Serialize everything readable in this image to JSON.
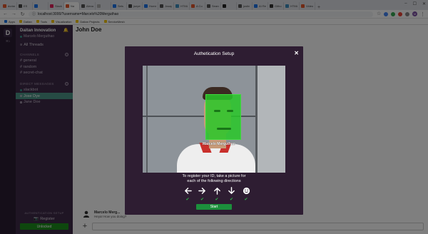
{
  "browser": {
    "tabs": [
      {
        "label": "doriar",
        "color": "#e2572b"
      },
      {
        "label": "ES",
        "color": "#444"
      },
      {
        "label": "",
        "color": "#1a73e8"
      },
      {
        "label": "Slack",
        "color": "#e01e5a"
      },
      {
        "label": "Na",
        "color": "#e2572b",
        "active": true
      },
      {
        "label": "Alexa",
        "color": "#555"
      },
      {
        "label": "",
        "color": "#aaa"
      },
      {
        "label": "Sets",
        "color": "#1a73e8"
      },
      {
        "label": "jseyes",
        "color": "#444"
      },
      {
        "label": "Home",
        "color": "#1a73e8"
      },
      {
        "label": "Josap",
        "color": "#555"
      },
      {
        "label": "HTML",
        "color": "#3c8dbc"
      },
      {
        "label": "A Co",
        "color": "#e2572b"
      },
      {
        "label": "Searc",
        "color": "#555"
      },
      {
        "label": "",
        "color": "#222"
      },
      {
        "label": "justin",
        "color": "#555"
      },
      {
        "label": "AI Re",
        "color": "#1a73e8"
      },
      {
        "label": "Githo",
        "color": "#333"
      },
      {
        "label": "HTML",
        "color": "#3c8dbc"
      },
      {
        "label": "Video",
        "color": "#e2572b"
      }
    ],
    "new_tab": "+",
    "window_controls": [
      "–",
      "☐",
      "✕"
    ],
    "nav": {
      "back": "←",
      "forward": "→",
      "reload": "↻"
    },
    "url": "localhost:3000/?username=Marcelo%20Merguthao",
    "profile_initial": "M",
    "bookmarks": [
      {
        "label": "Apps",
        "icon": "apps"
      },
      {
        "label": "Daitan"
      },
      {
        "label": "Tools"
      },
      {
        "label": "Visualization"
      },
      {
        "label": "Daitan Projects"
      },
      {
        "label": "ServiceMesh"
      }
    ]
  },
  "rail": {
    "logo": "D",
    "shortcut": "⌘1"
  },
  "sidebar": {
    "team_name": "Daitan Innovation",
    "bell_icon": "🔔",
    "current_user": "Marcelo Merguthao",
    "all_threads": "All Threads",
    "channels_header": "CHANNELS",
    "channels": [
      "# general",
      "# random",
      "# secret-chat"
    ],
    "dm_header": "DIRECT MESSAGES",
    "dms": [
      {
        "label": "slackbot",
        "active": false
      },
      {
        "label": "Jose Dye",
        "active": true
      },
      {
        "label": "Jane Doe",
        "active": false
      }
    ],
    "auth_header": "AUTHENTICATION SETUP",
    "register_label": "Register",
    "status_label": "Unlocked"
  },
  "main": {
    "title": "John Doe",
    "message": {
      "author": "Marcelo Merg...",
      "text": "Heya! How you doing?"
    },
    "composer": {
      "add": "+",
      "placeholder": ""
    }
  },
  "modal": {
    "title": "Authetication Setup",
    "close": "✕",
    "face_label": "Marcelo Merguthao",
    "instruction_line1": "To register your ID, take a picture for",
    "instruction_line2": "each of the following directions",
    "directions": [
      "left",
      "right",
      "up",
      "down",
      "smile"
    ],
    "checks": [
      "✔",
      "✔",
      "✔",
      "✔",
      "✔"
    ],
    "start_label": "Start",
    "accent": "#1c8f3c"
  }
}
